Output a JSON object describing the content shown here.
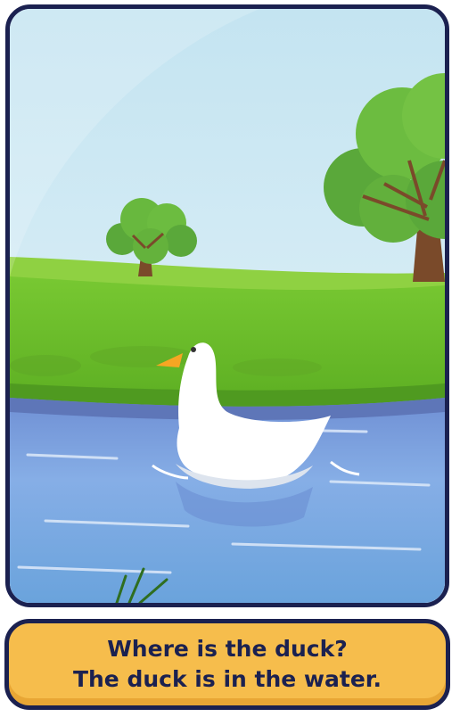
{
  "caption": {
    "question": "Where is the duck?",
    "answer": "The duck is in the water."
  },
  "scene": {
    "subject": "duck",
    "setting": "pond"
  },
  "colors": {
    "frame_border": "#1b2150",
    "caption_fill": "#f6bd4c",
    "caption_text": "#1b2150",
    "sky": "#cfe9f3",
    "grass": "#6cc02e",
    "water": "#7ea6dd",
    "duck": "#ffffff",
    "beak": "#f6a623"
  }
}
